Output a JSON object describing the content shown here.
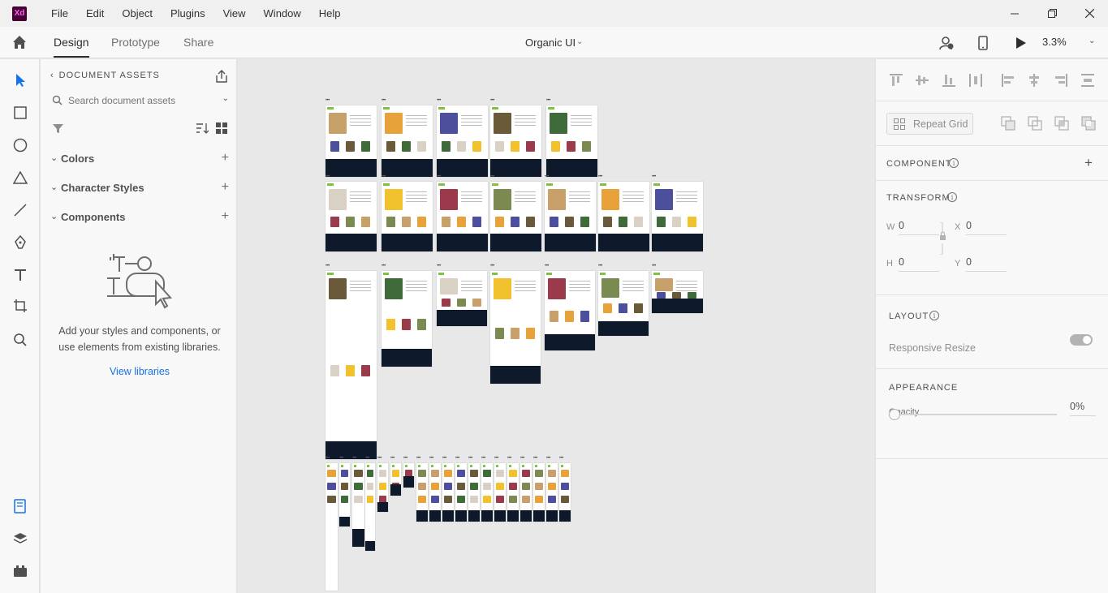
{
  "app": {
    "logo_text": "Xd",
    "menu": [
      "File",
      "Edit",
      "Object",
      "Plugins",
      "View",
      "Window",
      "Help"
    ]
  },
  "modebar": {
    "tabs": [
      "Design",
      "Prototype",
      "Share"
    ],
    "active_tab": "Design",
    "document_title": "Organic UI",
    "zoom": "3.3%"
  },
  "assets": {
    "header": "DOCUMENT ASSETS",
    "search_placeholder": "Search document assets",
    "sections": [
      "Colors",
      "Character Styles",
      "Components"
    ],
    "empty_message": "Add your styles and components, or use elements from existing libraries.",
    "view_libraries": "View libraries"
  },
  "canvas": {
    "artboard_label": "•••"
  },
  "inspector": {
    "repeat_grid": "Repeat Grid",
    "component_title": "COMPONENT",
    "transform_title": "TRANSFORM",
    "transform": {
      "w_label": "W",
      "w": "0",
      "x_label": "X",
      "x": "0",
      "h_label": "H",
      "h": "0",
      "y_label": "Y",
      "y": "0"
    },
    "layout_title": "LAYOUT",
    "responsive_resize": "Responsive Resize",
    "responsive_resize_on": true,
    "appearance_title": "APPEARANCE",
    "opacity_label": "Opacity",
    "opacity_value": "0%"
  },
  "colors": {
    "accent": "#1473e6",
    "footer_navy": "#0e1a2b",
    "leaf_green": "#7dc242",
    "xd_logo_bg": "#470137",
    "xd_logo_fg": "#ff61f6"
  }
}
